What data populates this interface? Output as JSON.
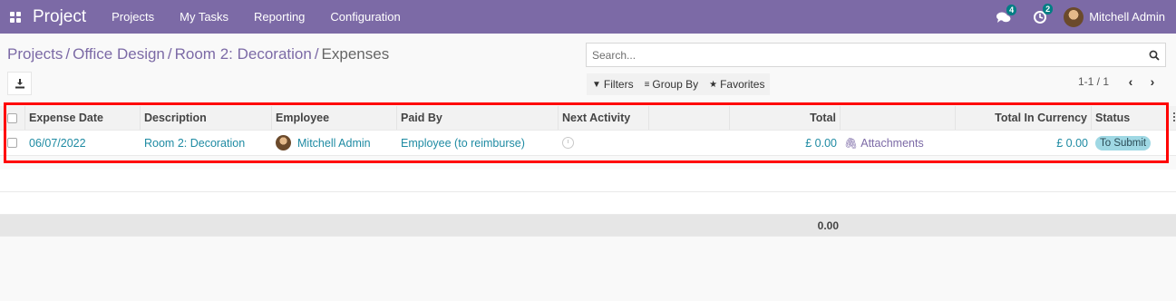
{
  "navbar": {
    "app_name": "Project",
    "menus": [
      "Projects",
      "My Tasks",
      "Reporting",
      "Configuration"
    ],
    "messages_count": "4",
    "activities_count": "2",
    "user_name": "Mitchell Admin",
    "bg_color": "#7c6aa6"
  },
  "breadcrumb": {
    "items": [
      "Projects",
      "Office Design",
      "Room 2: Decoration"
    ],
    "current": "Expenses",
    "separator": "/"
  },
  "search": {
    "placeholder": "Search..."
  },
  "filters": {
    "filters_label": "Filters",
    "group_by_label": "Group By",
    "favorites_label": "Favorites"
  },
  "pager": {
    "value": "1-1 / 1"
  },
  "table": {
    "headers": {
      "expense_date": "Expense Date",
      "description": "Description",
      "employee": "Employee",
      "paid_by": "Paid By",
      "next_activity": "Next Activity",
      "total": "Total",
      "total_in_currency": "Total In Currency",
      "status": "Status"
    },
    "rows": [
      {
        "expense_date": "06/07/2022",
        "description": "Room 2: Decoration",
        "employee": "Mitchell Admin",
        "paid_by": "Employee (to reimburse)",
        "total": "£ 0.00",
        "attachments": "Attachments",
        "total_in_currency": "£ 0.00",
        "status": "To Submit"
      }
    ],
    "footer_total": "0.00"
  }
}
